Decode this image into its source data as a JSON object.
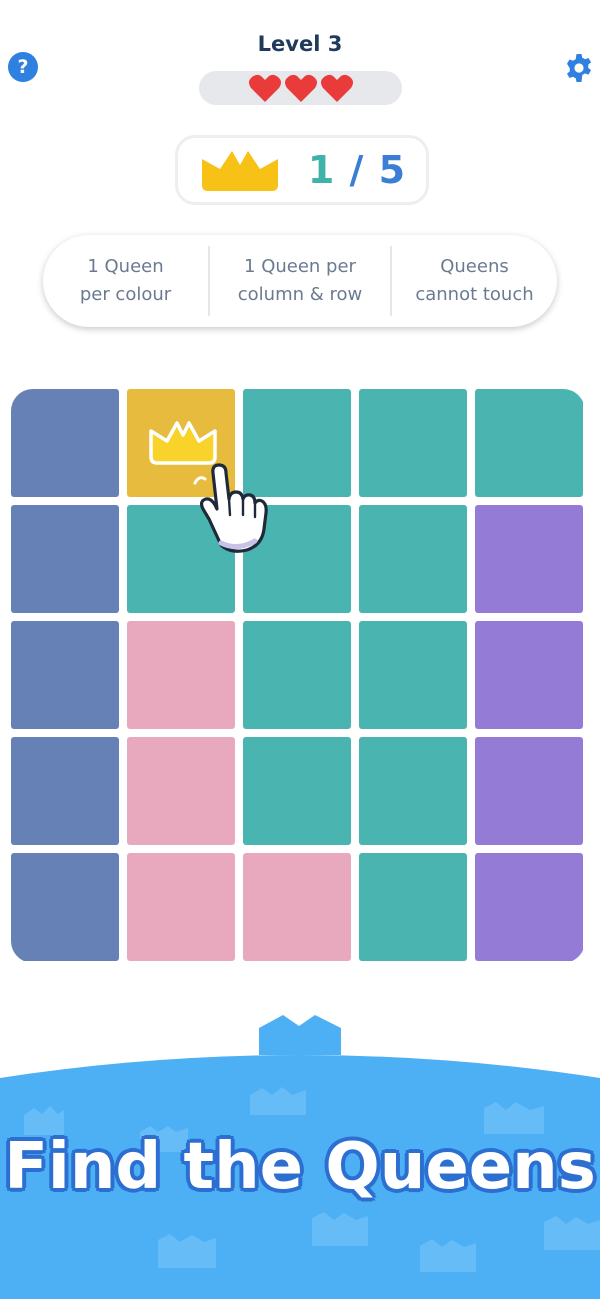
{
  "header": {
    "help_label": "?",
    "level_title": "Level 3",
    "lives": 3
  },
  "score": {
    "current": "1",
    "separator": "/",
    "total": "5"
  },
  "rules": [
    "1 Queen\nper colour",
    "1 Queen per\ncolumn & row",
    "Queens\ncannot touch"
  ],
  "board": {
    "size": 5,
    "colors": {
      "slate": "#6581b5",
      "teal": "#4ab4b0",
      "yellow": "#e6bb3e",
      "purple": "#947cd6",
      "pink": "#e8a9bf"
    },
    "cells": [
      [
        "slate",
        "yellow",
        "teal",
        "teal",
        "teal"
      ],
      [
        "slate",
        "teal",
        "teal",
        "teal",
        "purple"
      ],
      [
        "slate",
        "pink",
        "teal",
        "teal",
        "purple"
      ],
      [
        "slate",
        "pink",
        "teal",
        "teal",
        "purple"
      ],
      [
        "slate",
        "pink",
        "pink",
        "teal",
        "purple"
      ]
    ],
    "queens": [
      {
        "row": 0,
        "col": 1
      }
    ]
  },
  "footer": {
    "tagline": "Find the Queens",
    "background_color": "#4db0f5",
    "outline_color": "#2c6fd1"
  },
  "icons": {
    "help": "question-mark-icon",
    "settings": "gear-icon",
    "score": "crown-icon",
    "pointer": "pointing-hand-icon"
  }
}
